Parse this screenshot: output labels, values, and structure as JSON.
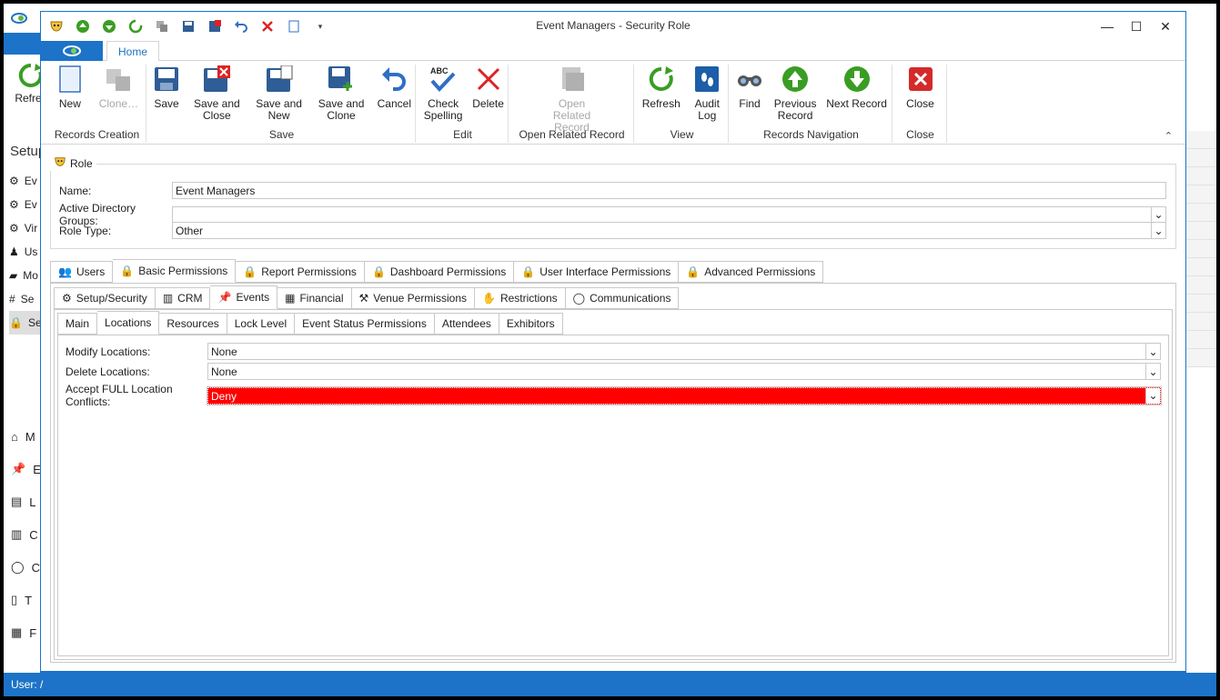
{
  "background_app": {
    "refresh_label": "Refres",
    "setup_label": "Setup",
    "list_items": [
      "Ev",
      "Ev",
      "Vir",
      "Us",
      "Mo",
      "Se",
      "Se"
    ],
    "bottom_items": [
      "M",
      "E",
      "L",
      "C",
      "C",
      "T",
      "F"
    ],
    "status_text": "User: /"
  },
  "window": {
    "title": "Event Managers - Security Role",
    "minimize": "—",
    "maximize": "☐",
    "close": "✕"
  },
  "ribbon": {
    "home_tab": "Home",
    "groups": [
      {
        "label": "Records Creation",
        "buttons": [
          {
            "label": "New",
            "icon": "new-document-icon"
          },
          {
            "label": "Clone…",
            "icon": "clone-icon",
            "disabled": true
          }
        ]
      },
      {
        "label": "Save",
        "buttons": [
          {
            "label": "Save",
            "icon": "save-icon"
          },
          {
            "label": "Save and Close",
            "icon": "save-close-icon"
          },
          {
            "label": "Save and New",
            "icon": "save-new-icon"
          },
          {
            "label": "Save and Clone",
            "icon": "save-clone-icon"
          },
          {
            "label": "Cancel",
            "icon": "undo-icon"
          }
        ]
      },
      {
        "label": "Edit",
        "buttons": [
          {
            "label": "Check Spelling",
            "icon": "spellcheck-icon"
          },
          {
            "label": "Delete",
            "icon": "delete-icon"
          }
        ]
      },
      {
        "label": "Open Related Record",
        "buttons": [
          {
            "label": "Open Related Record",
            "icon": "related-record-icon",
            "disabled": true
          }
        ]
      },
      {
        "label": "View",
        "buttons": [
          {
            "label": "Refresh",
            "icon": "refresh-icon"
          },
          {
            "label": "Audit Log",
            "icon": "audit-log-icon"
          }
        ]
      },
      {
        "label": "Records Navigation",
        "buttons": [
          {
            "label": "Find",
            "icon": "binoculars-icon"
          },
          {
            "label": "Previous Record",
            "icon": "up-arrow-icon"
          },
          {
            "label": "Next Record",
            "icon": "down-arrow-icon"
          }
        ]
      },
      {
        "label": "Close",
        "buttons": [
          {
            "label": "Close",
            "icon": "close-red-icon"
          }
        ]
      }
    ]
  },
  "role": {
    "header": "Role",
    "name_label": "Name:",
    "name_value": "Event Managers",
    "ad_label": "Active Directory Groups:",
    "ad_value": "",
    "type_label": "Role Type:",
    "type_value": "Other"
  },
  "tabs_level1": [
    "Users",
    "Basic Permissions",
    "Report Permissions",
    "Dashboard Permissions",
    "User Interface Permissions",
    "Advanced Permissions"
  ],
  "tabs_level2": [
    "Setup/Security",
    "CRM",
    "Events",
    "Financial",
    "Venue Permissions",
    "Restrictions",
    "Communications"
  ],
  "tabs_level3": [
    "Main",
    "Locations",
    "Resources",
    "Lock Level",
    "Event Status Permissions",
    "Attendees",
    "Exhibitors"
  ],
  "permissions": {
    "modify_label": "Modify Locations:",
    "modify_value": "None",
    "delete_label": "Delete Locations:",
    "delete_value": "None",
    "conflicts_label": "Accept FULL Location Conflicts:",
    "conflicts_value": "Deny",
    "highlight_color": "#ff0000"
  },
  "colors": {
    "accent": "#1c73c7"
  }
}
